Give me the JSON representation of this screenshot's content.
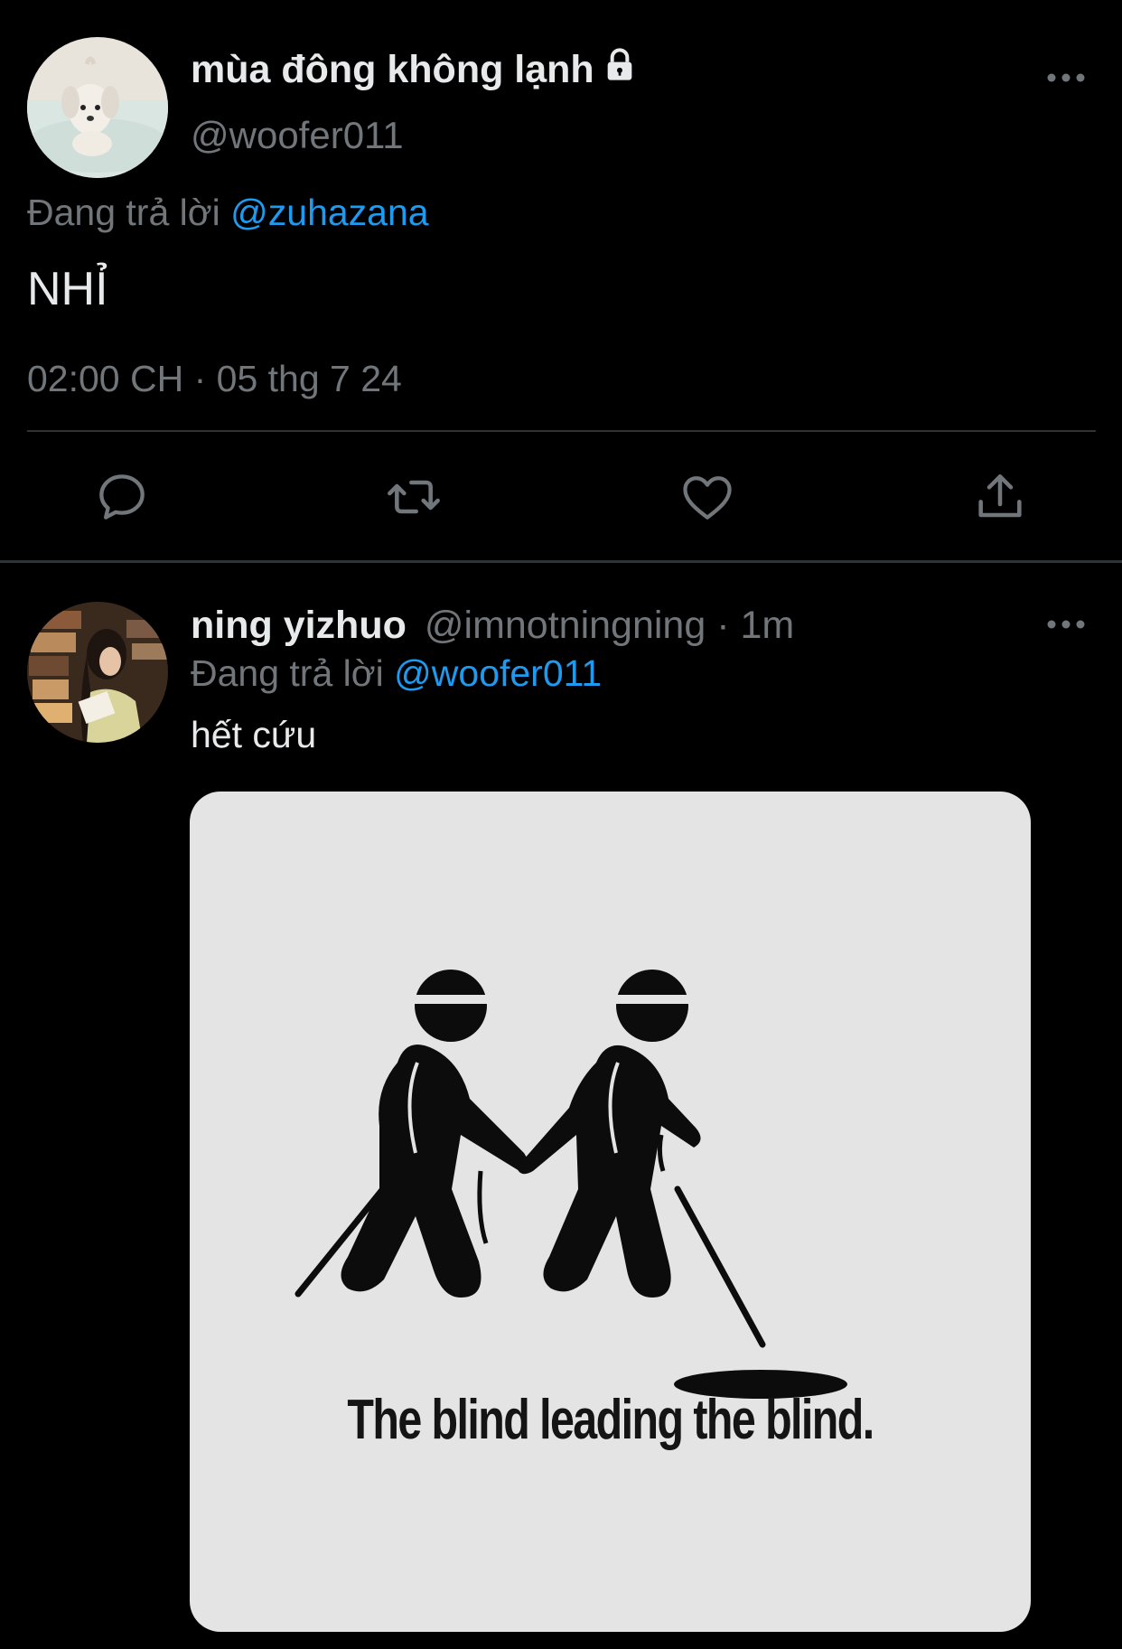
{
  "focused_tweet": {
    "display_name": "mùa đông không lạnh",
    "locked_icon": "lock-icon",
    "handle": "@woofer011",
    "replying_prefix": "Đang trả lời",
    "replying_to": "@zuhazana",
    "text": "NHỈ",
    "timestamp": "02:00 CH · 05 thg 7 24",
    "more_icon": "more-icon",
    "actions": [
      {
        "name": "reply",
        "icon": "reply-icon"
      },
      {
        "name": "retweet",
        "icon": "retweet-icon"
      },
      {
        "name": "like",
        "icon": "heart-icon"
      },
      {
        "name": "share",
        "icon": "share-icon"
      }
    ]
  },
  "reply_tweet": {
    "display_name": "ning yizhuo",
    "handle_meta": "@imnotningning · 1m",
    "replying_prefix": "Đang trả lời",
    "replying_to": "@woofer011",
    "text": "hết cứu",
    "media_caption": "The blind leading the blind.",
    "more_icon": "more-icon"
  },
  "colors": {
    "background": "#000000",
    "text_primary": "#e7e9ea",
    "text_secondary": "#71767b",
    "link": "#1d9bf0",
    "divider": "#2f3336"
  }
}
